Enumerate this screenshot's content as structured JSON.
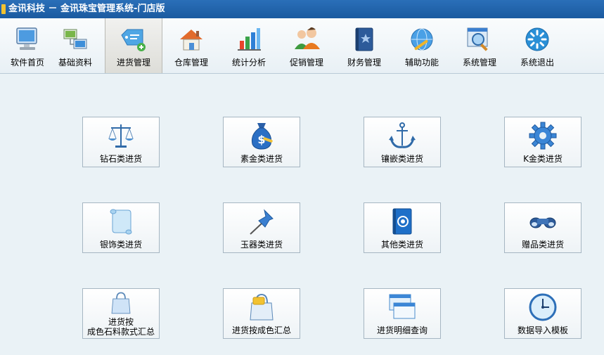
{
  "window": {
    "title": "金讯科技 － 金讯珠宝管理系统-门店版"
  },
  "toolbar": {
    "items": [
      {
        "label": "软件首页",
        "icon": "monitor-icon"
      },
      {
        "label": "基础资料",
        "icon": "network-computers-icon"
      },
      {
        "label": "进货管理",
        "icon": "price-tag-add-icon",
        "active": true
      },
      {
        "label": "仓库管理",
        "icon": "house-icon"
      },
      {
        "label": "统计分析",
        "icon": "bar-chart-icon"
      },
      {
        "label": "促销管理",
        "icon": "people-icon"
      },
      {
        "label": "财务管理",
        "icon": "book-star-icon"
      },
      {
        "label": "辅助功能",
        "icon": "globe-tools-icon"
      },
      {
        "label": "系统管理",
        "icon": "magnifier-window-icon"
      },
      {
        "label": "系统退出",
        "icon": "loading-exit-icon"
      }
    ]
  },
  "tiles": {
    "diamond": "钻石类进货",
    "gold": "素金类进货",
    "inlay": "镶嵌类进货",
    "kgold": "K金类进货",
    "silver": "银饰类进货",
    "jade": "玉器类进货",
    "other": "其他类进货",
    "gift": "赠品类进货",
    "summary_style_line1": "进货按",
    "summary_style_line2": "成色石料款式汇总",
    "summary_purity": "进货按成色汇总",
    "detail_query": "进货明细查询",
    "import_template": "数据导入模板"
  },
  "colors": {
    "titlebar": "#1f62ab",
    "toolbar_active": "#e3e3df",
    "background": "#eaf2f6"
  }
}
